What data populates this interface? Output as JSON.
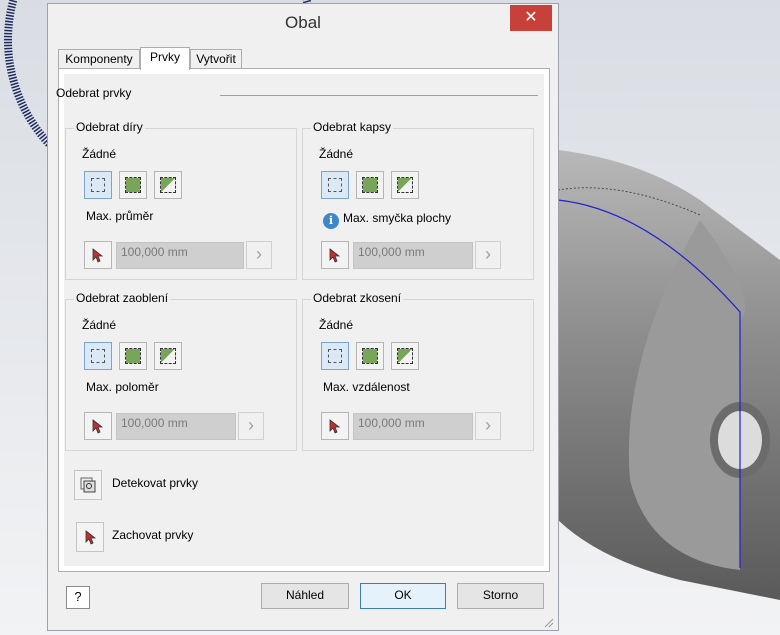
{
  "window": {
    "title": "Obal",
    "close_glyph": "✕"
  },
  "tabs": [
    {
      "label": "Komponenty",
      "active": false
    },
    {
      "label": "Prvky",
      "active": true
    },
    {
      "label": "Vytvořit",
      "active": false
    }
  ],
  "section": {
    "title": "Odebrat prvky"
  },
  "groups": {
    "holes": {
      "title": "Odebrat díry",
      "mode": "Žádné",
      "param_label": "Max. průměr",
      "value": "100,000 mm"
    },
    "pockets": {
      "title": "Odebrat kapsy",
      "mode": "Žádné",
      "param_label": "Max. smyčka plochy",
      "value": "100,000 mm",
      "info_glyph": "i"
    },
    "fillets": {
      "title": "Odebrat zaoblení",
      "mode": "Žádné",
      "param_label": "Max. poloměr",
      "value": "100,000 mm"
    },
    "chamfers": {
      "title": "Odebrat zkosení",
      "mode": "Žádné",
      "param_label": "Max. vzdálenost",
      "value": "100,000 mm"
    }
  },
  "actions": {
    "detect": "Detekovat prvky",
    "keep": "Zachovat prvky"
  },
  "buttons": {
    "help": "?",
    "preview": "Náhled",
    "ok": "OK",
    "cancel": "Storno"
  },
  "arrow_glyph": "›",
  "colors": {
    "close": "#c7403a",
    "accent_border": "#3c7fb1",
    "feature_green": "#78a55a",
    "info_blue": "#3c88c8"
  }
}
